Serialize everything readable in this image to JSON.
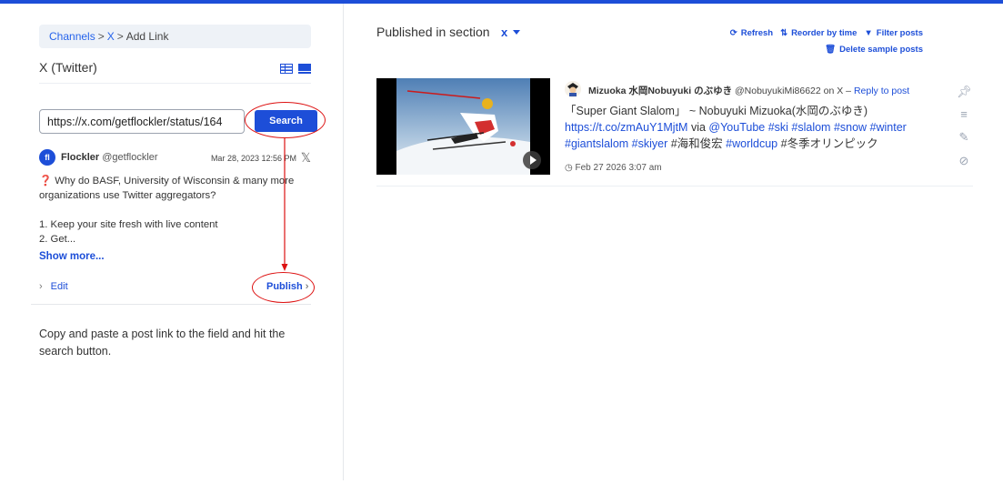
{
  "left": {
    "breadcrumb": {
      "channels": "Channels",
      "sep1": ">",
      "x": "X",
      "sep2": ">",
      "current": "Add Link"
    },
    "title": "X (Twitter)",
    "url_input": {
      "value": "https://x.com/getflockler/status/164",
      "placeholder": ""
    },
    "search_label": "Search",
    "preview": {
      "logo_text": "fl",
      "author": "Flockler",
      "handle": "@getflockler",
      "date": "Mar 28, 2023 12:56 PM",
      "x_glyph": "𝕏",
      "question_mark": "❓",
      "line1": "Why do BASF, University of Wisconsin & many more organizations use Twitter aggregators?",
      "line2": "1. Keep your site fresh with live content",
      "line3": "2. Get...",
      "show_more": "Show more..."
    },
    "edit_label": "Edit",
    "publish_label": "Publish",
    "instructions": "Copy and paste a post link to the field and hit the search button."
  },
  "right": {
    "published_label": "Published in section",
    "section": "x",
    "toolbar": {
      "refresh": "Refresh",
      "reorder": "Reorder by time",
      "filter": "Filter posts",
      "delete": "Delete sample posts"
    },
    "post": {
      "author": "Mizuoka 水岡Nobuyuki のぶゆき",
      "handle": "@NobuyukiMi86622",
      "on_network": "on X –",
      "reply": "Reply to post",
      "text_plain": "「Super Giant Slalom」 ~ Nobuyuki Mizuoka(水岡のぶゆき)",
      "link": "https://t.co/zmAuY1MjtM",
      "via": " via ",
      "youtube": "@YouTube",
      "tags1": " #ski #slalom #snow #winter",
      "tags2": "#giantslalom #skiyer",
      "tag_jp1": " #海和俊宏 ",
      "tag_wc": "#worldcup",
      "tag_jp2": " #冬季オリンピック",
      "date": "Feb 27 2026 3:07 am"
    }
  },
  "colors": {
    "accent": "#1d4ed8",
    "annotation": "#dd1111",
    "topbar": "#1d4ed8"
  },
  "icons": [
    "refresh-icon",
    "sort-icon",
    "filter-icon",
    "trash-icon",
    "pin-icon",
    "menu-icon",
    "edit-icon",
    "hide-icon",
    "clock-icon",
    "play-icon",
    "x-logo-icon",
    "list-view-icon",
    "grid-view-icon"
  ]
}
